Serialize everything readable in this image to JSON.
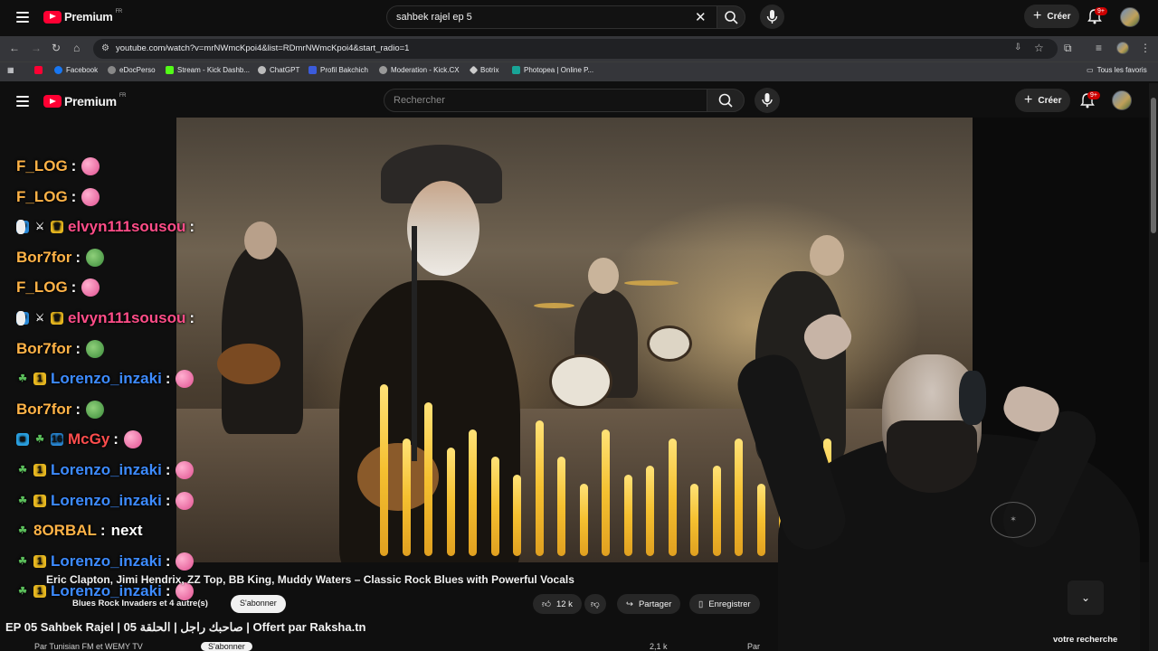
{
  "top_bar": {
    "logo_text": "Premium",
    "logo_region": "FR",
    "search_value": "sahbek rajel ep 5",
    "create_label": "Créer",
    "notif_count": "9+"
  },
  "browser": {
    "url": "youtube.com/watch?v=mrNWmcKpoi4&list=RDmrNWmcKpoi4&start_radio=1",
    "bookmarks": [
      {
        "label": "",
        "color": "#ff0033"
      },
      {
        "label": "Facebook",
        "color": "#1877f2"
      },
      {
        "label": "eDocPerso",
        "color": "#cccccc"
      },
      {
        "label": "Stream - Kick Dashb...",
        "color": "#53fc18"
      },
      {
        "label": "ChatGPT",
        "color": "#cccccc"
      },
      {
        "label": "Profil Bakchich",
        "color": "#3b5bdb"
      },
      {
        "label": "Moderation - Kick.CX",
        "color": "#cccccc"
      },
      {
        "label": "Botrix",
        "color": "#cccccc"
      },
      {
        "label": "Photopea | Online P...",
        "color": "#18a497"
      }
    ],
    "all_bookmarks": "Tous les favoris"
  },
  "main_header": {
    "logo_text": "Premium",
    "logo_region": "FR",
    "search_placeholder": "Rechercher",
    "create_label": "Créer",
    "notif_count": "9+"
  },
  "chat": {
    "lines": [
      {
        "user": "F_LOG",
        "color": "#ffb347",
        "msg": "",
        "emote": "heart",
        "badges": []
      },
      {
        "user": "F_LOG",
        "color": "#ffb347",
        "msg": "",
        "emote": "heart",
        "badges": []
      },
      {
        "user": "elvyn111sousou",
        "color": "#ff4d88",
        "msg": "",
        "emote": "hand",
        "badges": [
          "blue",
          "sword",
          "crown"
        ]
      },
      {
        "user": "Bor7for",
        "color": "#ffb347",
        "msg": "",
        "emote": "pepe",
        "badges": []
      },
      {
        "user": "F_LOG",
        "color": "#ffb347",
        "msg": "",
        "emote": "heart",
        "badges": []
      },
      {
        "user": "elvyn111sousou",
        "color": "#ff4d88",
        "msg": "",
        "emote": "hand",
        "badges": [
          "blue",
          "sword",
          "crown"
        ]
      },
      {
        "user": "Bor7for",
        "color": "#ffb347",
        "msg": "",
        "emote": "pepe",
        "badges": []
      },
      {
        "user": "Lorenzo_inzaki",
        "color": "#3d8bff",
        "msg": "",
        "emote": "heart",
        "badges": [
          "leaf",
          "one"
        ]
      },
      {
        "user": "Bor7for",
        "color": "#ffb347",
        "msg": "",
        "emote": "pepe",
        "badges": []
      },
      {
        "user": "McGy",
        "color": "#ff4d4d",
        "msg": "",
        "emote": "heart",
        "badges": [
          "cube",
          "leaf",
          "sixteen"
        ]
      },
      {
        "user": "Lorenzo_inzaki",
        "color": "#3d8bff",
        "msg": "",
        "emote": "heart",
        "badges": [
          "leaf",
          "one"
        ]
      },
      {
        "user": "Lorenzo_inzaki",
        "color": "#3d8bff",
        "msg": "",
        "emote": "heart",
        "badges": [
          "leaf",
          "one"
        ]
      },
      {
        "user": "8ORBAL",
        "color": "#ffb347",
        "msg": "next",
        "emote": "",
        "badges": [
          "leaf"
        ]
      },
      {
        "user": "Lorenzo_inzaki",
        "color": "#3d8bff",
        "msg": "",
        "emote": "heart",
        "badges": [
          "leaf",
          "one"
        ]
      },
      {
        "user": "Lorenzo_inzaki",
        "color": "#3d8bff",
        "msg": "",
        "emote": "heart",
        "badges": [
          "leaf",
          "one"
        ]
      }
    ]
  },
  "video": {
    "title": "Eric Clapton, Jimi Hendrix, ZZ Top, BB King, Muddy Waters – Classic Rock Blues with Powerful Vocals",
    "channel": "Blues Rock Invaders et 4 autre(s)",
    "subscribe_label": "S'abonner",
    "likes": "12 k",
    "share_label": "Partager",
    "save_label": "Enregistrer"
  },
  "page": {
    "bottom_title": "EP 05 Sahbek Rajel | صاحبك راجل | الحلقة 05 | Offert par Raksha.tn",
    "search_hint": "votre recherche",
    "partial_channel": "Par Tunisian FM et WEMY TV",
    "partial_subscribe": "S'abonner",
    "partial_likes": "2,1 k",
    "partial_share": "Par"
  }
}
